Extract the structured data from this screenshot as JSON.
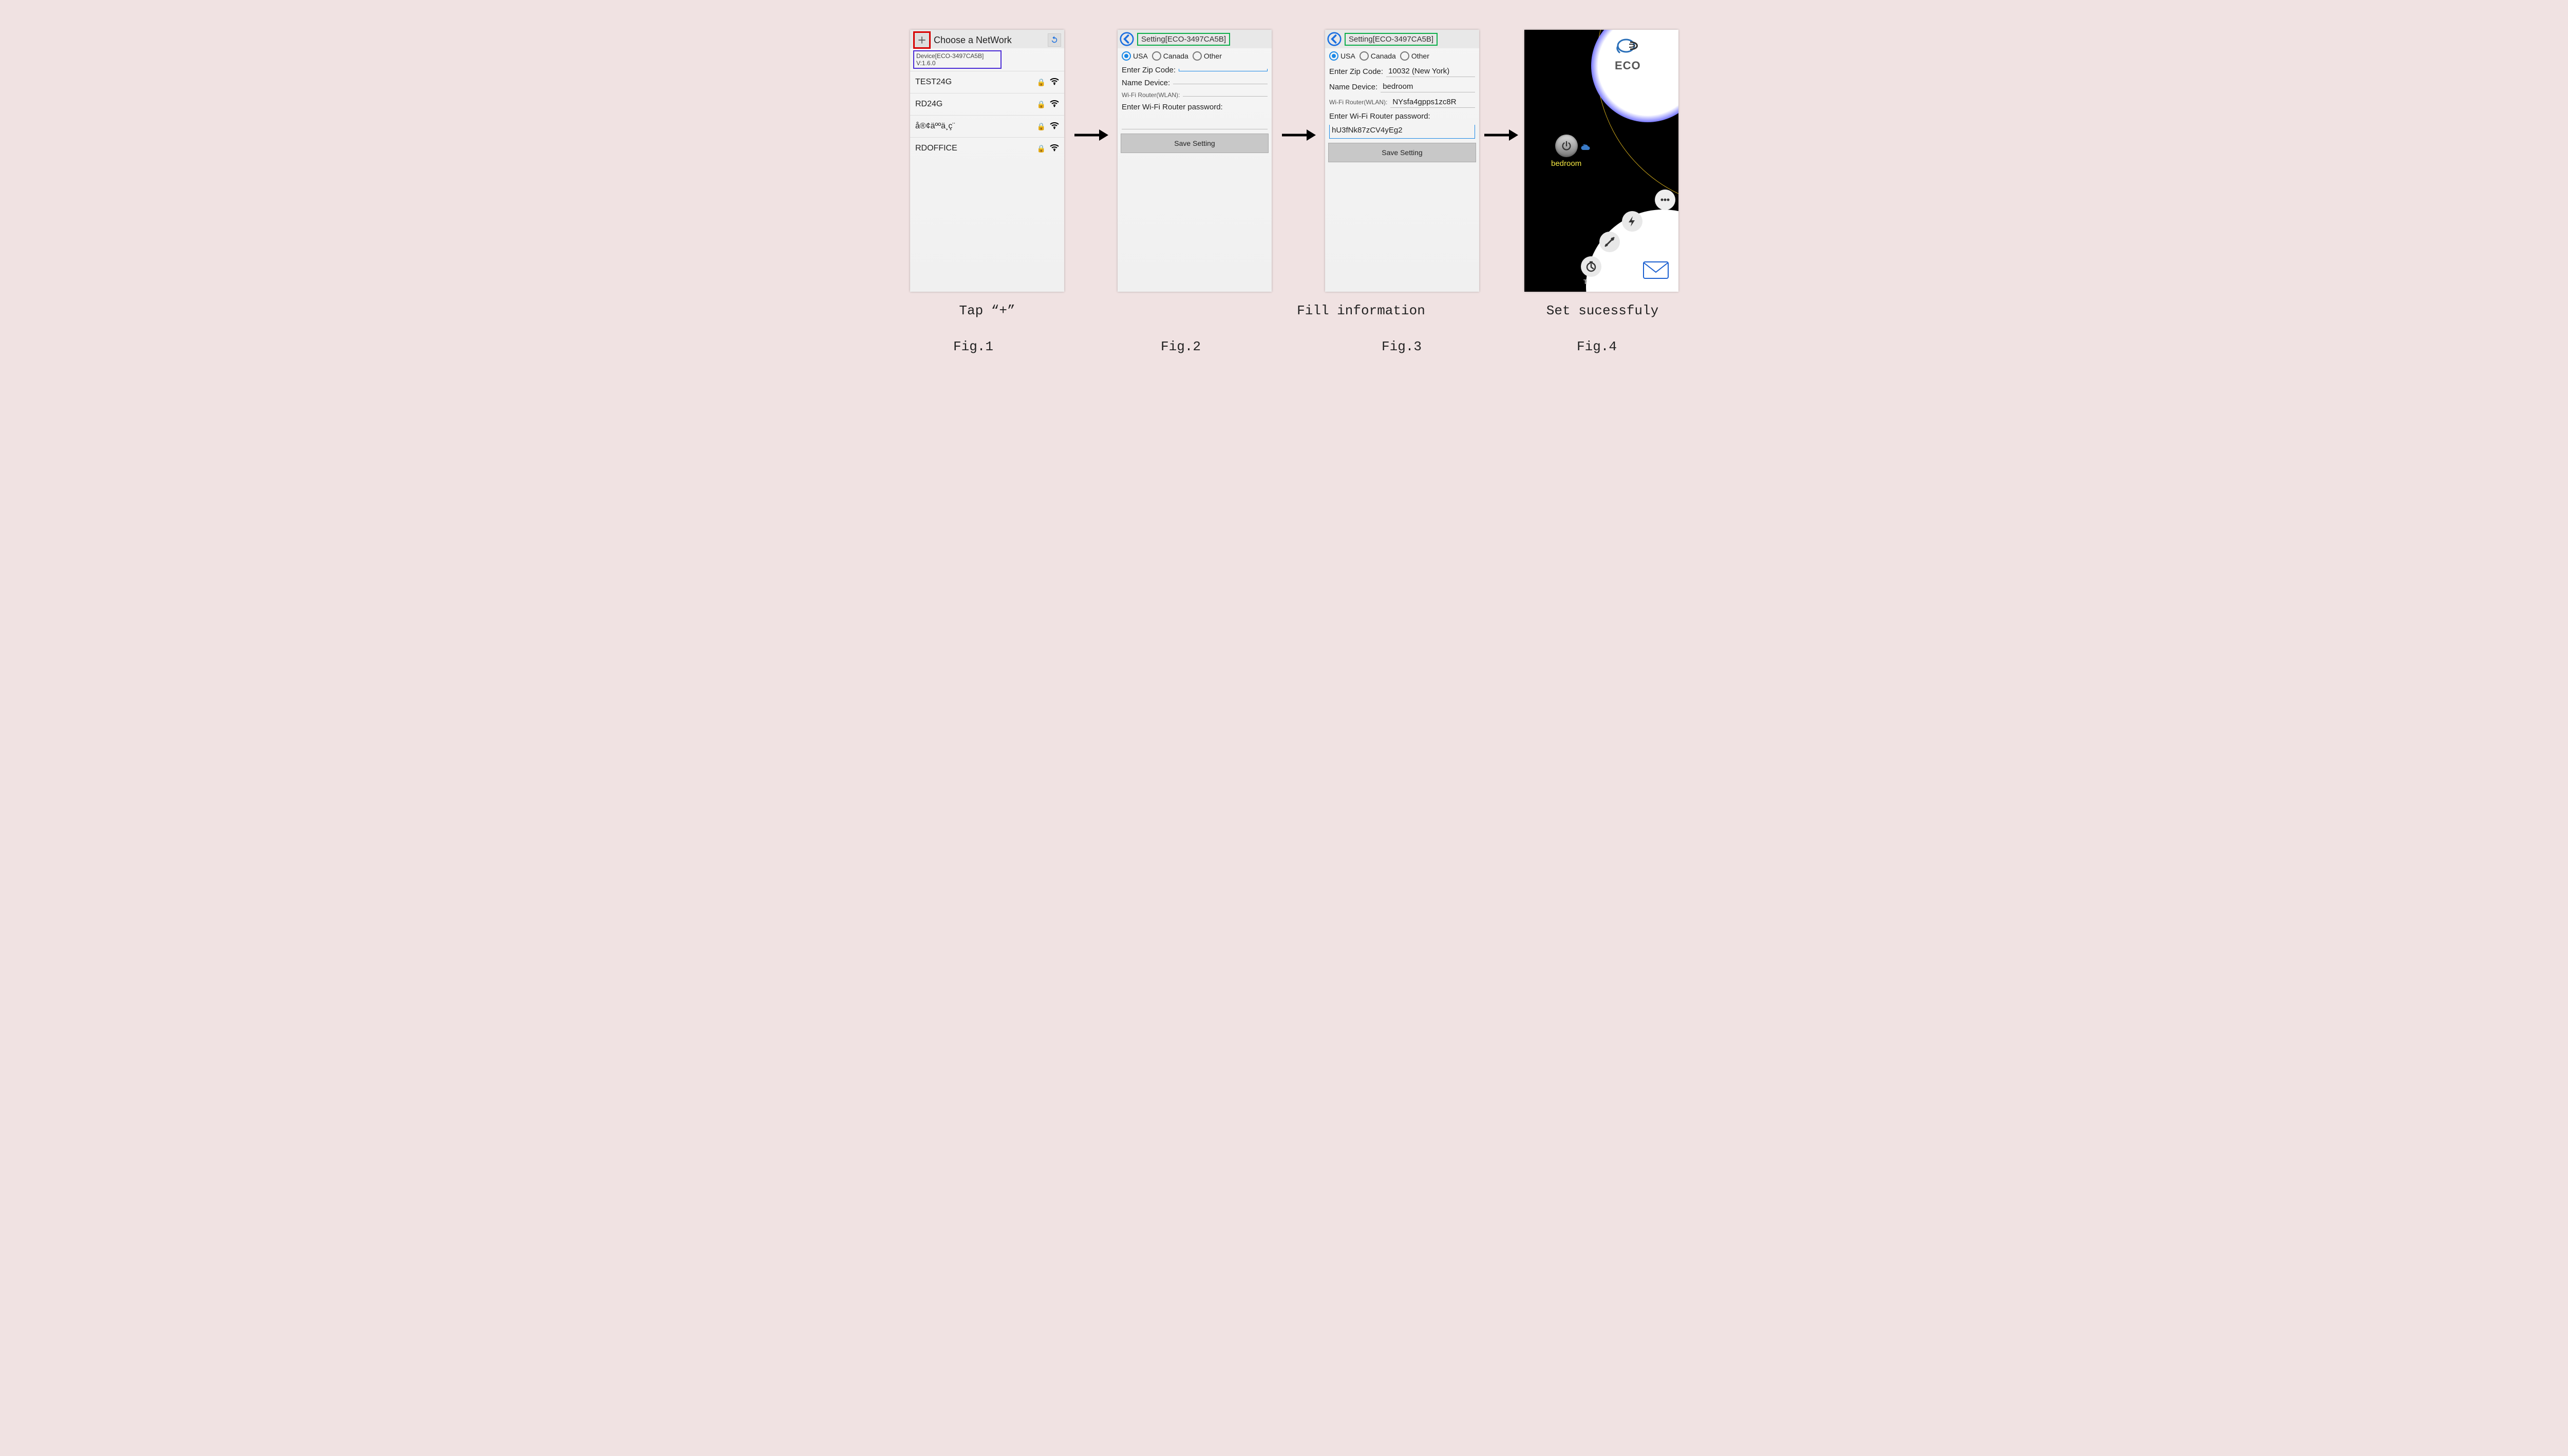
{
  "captions": {
    "c1": "Tap “+”",
    "c3": "Fill information",
    "c4": "Set sucessfuly",
    "f1": "Fig.1",
    "f2": "Fig.2",
    "f3": "Fig.3",
    "f4": "Fig.4"
  },
  "phone1": {
    "title": "Choose a NetWork",
    "device_line": "Device[ECO-3497CA5B] V:1.6.0",
    "networks": [
      {
        "name": "TEST24G",
        "locked": true
      },
      {
        "name": "RD24G",
        "locked": true
      },
      {
        "name": "å®¢äººä¸­ç­¨",
        "locked": true
      },
      {
        "name": "RDOFFICE",
        "locked": true
      }
    ]
  },
  "settings": {
    "header": "Setting[ECO-3497CA5B]",
    "regions": [
      "USA",
      "Canada",
      "Other"
    ],
    "zip_label": "Enter Zip Code:",
    "name_label": "Name Device:",
    "wlan_label": "Wi-Fi Router(WLAN):",
    "pw_label": "Enter Wi-Fi Router password:",
    "save": "Save Setting"
  },
  "filled": {
    "zip": "10032 (New York)",
    "name": "bedroom",
    "wlan": "NYsfa4gpps1zc8R",
    "pw": "hU3fNk87zCV4yEg2"
  },
  "dash": {
    "brand": "ECO",
    "device": "bedroom",
    "menu": {
      "timer": "Timer",
      "setting": "Setting",
      "bill": "Electric Bill",
      "more": "More"
    }
  }
}
